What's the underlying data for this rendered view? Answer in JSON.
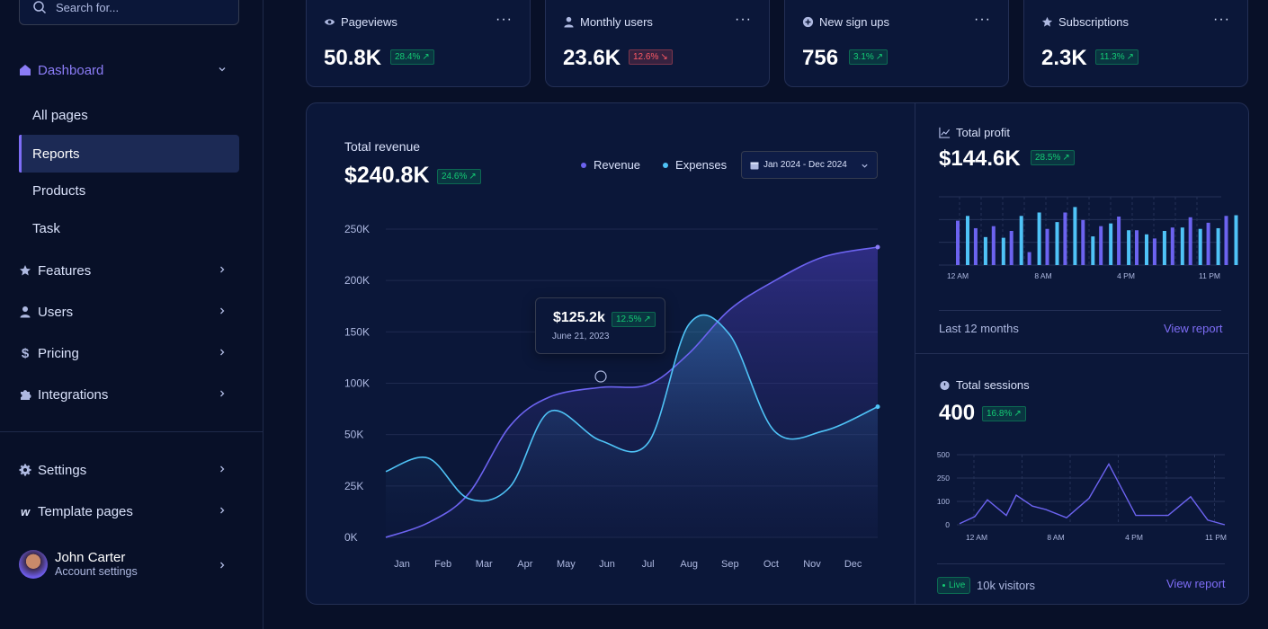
{
  "sidebar": {
    "search_placeholder": "Search for...",
    "dashboard_label": "Dashboard",
    "sub_items": [
      {
        "label": "All pages"
      },
      {
        "label": "Reports"
      },
      {
        "label": "Products"
      },
      {
        "label": "Task"
      }
    ],
    "items": [
      {
        "label": "Features",
        "icon": "star-icon"
      },
      {
        "label": "Users",
        "icon": "user-icon"
      },
      {
        "label": "Pricing",
        "icon": "dollar-icon"
      },
      {
        "label": "Integrations",
        "icon": "puzzle-icon"
      }
    ],
    "settings_label": "Settings",
    "template_label": "Template pages",
    "user": {
      "name": "John Carter",
      "subtitle": "Account settings"
    }
  },
  "stats": [
    {
      "label": "Pageviews",
      "icon": "eye-icon",
      "value": "50.8K",
      "change": "28.4%",
      "trend": "up"
    },
    {
      "label": "Monthly users",
      "icon": "user-icon",
      "value": "23.6K",
      "change": "12.6%",
      "trend": "down"
    },
    {
      "label": "New sign ups",
      "icon": "plus-circle-icon",
      "value": "756",
      "change": "3.1%",
      "trend": "up"
    },
    {
      "label": "Subscriptions",
      "icon": "star-icon",
      "value": "2.3K",
      "change": "11.3%",
      "trend": "up"
    }
  ],
  "revenue": {
    "title": "Total revenue",
    "value": "$240.8K",
    "change": "24.6%",
    "legend_revenue": "Revenue",
    "legend_expenses": "Expenses",
    "date_range": "Jan 2024 - Dec 2024",
    "tooltip_value": "$125.2k",
    "tooltip_change": "12.5%",
    "tooltip_date": "June 21, 2023"
  },
  "profit": {
    "title": "Total profit",
    "value": "$144.6K",
    "change": "28.5%",
    "footer": "Last 12 months",
    "link": "View report"
  },
  "sessions": {
    "title": "Total sessions",
    "value": "400",
    "change": "16.8%",
    "live": "Live",
    "visitors": "10k visitors",
    "link": "View report"
  },
  "colors": {
    "accent": "#7e6df6",
    "revenue": "#6c63f0",
    "expenses": "#4fc3f7",
    "positive": "#14ca74",
    "negative": "#ff5a65",
    "background": "#081028",
    "card": "#0b1739"
  },
  "chart_data": [
    {
      "type": "area",
      "categories": [
        "Jan",
        "Feb",
        "Mar",
        "Apr",
        "May",
        "Jun",
        "Jul",
        "Aug",
        "Sep",
        "Oct",
        "Nov",
        "Dec"
      ],
      "yticks": [
        "0K",
        "25K",
        "50K",
        "100K",
        "150K",
        "200K",
        "250K"
      ],
      "series": [
        {
          "name": "Revenue",
          "values": [
            0,
            15,
            45,
            115,
            145,
            155,
            158,
            190,
            235,
            265,
            290,
            300
          ]
        },
        {
          "name": "Expenses",
          "values": [
            68,
            82,
            40,
            52,
            130,
            100,
            98,
            220,
            210,
            110,
            110,
            135
          ]
        }
      ]
    },
    {
      "type": "bar",
      "xticks": [
        "12 AM",
        "8 AM",
        "4 PM",
        "11 PM"
      ],
      "series": [
        {
          "name": "a",
          "values": [
            65,
            54,
            57,
            50,
            19,
            53,
            77,
            66,
            57,
            71,
            51,
            39,
            55,
            70,
            62,
            72
          ]
        },
        {
          "name": "b",
          "values": [
            72,
            41,
            40,
            72,
            77,
            63,
            85,
            42,
            61,
            51,
            45,
            50,
            55,
            53,
            54,
            73
          ]
        }
      ]
    },
    {
      "type": "line",
      "yticks": [
        "0",
        "100",
        "250",
        "500"
      ],
      "xticks": [
        "12 AM",
        "8 AM",
        "4 PM",
        "11 PM"
      ],
      "values": [
        5,
        35,
        110,
        40,
        140,
        80,
        65,
        30,
        120,
        400,
        40,
        40,
        40,
        130,
        20,
        0
      ]
    }
  ]
}
